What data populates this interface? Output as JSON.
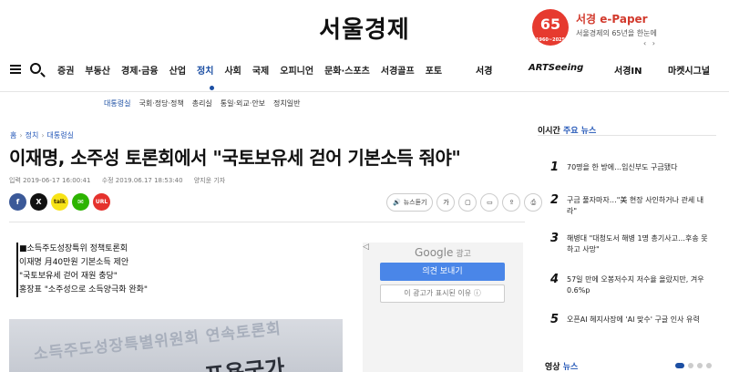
{
  "header": {
    "logo": "서울경제",
    "epaper": {
      "badge": "65",
      "badge_years": "1960~2025",
      "title": "서경 e-Paper",
      "subtitle": "서울경제의 65년을 한눈에",
      "arrows": "‹ ›"
    }
  },
  "nav": {
    "items": [
      "증권",
      "부동산",
      "경제·금융",
      "산업",
      "정치",
      "사회",
      "국제",
      "오피니언",
      "문화·스포츠",
      "서경골프",
      "포토"
    ],
    "active": "정치",
    "brands": [
      "서경",
      "ARTSeeing",
      "서경IN",
      "마켓시그널"
    ]
  },
  "subnav": {
    "items": [
      "대통령실",
      "국회·정당·정책",
      "총리실",
      "통일·외교·안보",
      "정치일반"
    ],
    "active": "대통령실"
  },
  "article": {
    "breadcrumb": [
      "홈",
      "정치",
      "대통령실"
    ],
    "headline": "이재명, 소주성 토론회에서 \"국토보유세 걷어 기본소득 줘야\"",
    "published": "입력 2019-06-17 16:00:41",
    "modified": "수정 2019.06.17 18:53:40",
    "author": "양지윤 기자",
    "share": [
      "f",
      "X",
      "talk",
      "✉",
      "URL"
    ],
    "tools": {
      "listen": "뉴스듣기",
      "font": "가"
    },
    "summary": [
      "■소득주도성장특위 정책토론회",
      "이재명 月40만원 기본소득 제안",
      "\"국토보유세 걷어 재원 충당\"",
      "홍장표 \"소주성으로 소득양극화 완화\""
    ],
    "photo_text": "소득주도성장특별위원회 연속토론회",
    "photo_text_big": "포용국가"
  },
  "ad": {
    "label": "Google",
    "label_small": "광고",
    "button_primary": "의견 보내기",
    "button_secondary": "이 광고가 표시된 이유 ⓘ",
    "close": "◁"
  },
  "sidebar": {
    "popular_title_a": "이시간",
    "popular_title_b": "주요 뉴스",
    "popular": [
      {
        "rank": "1",
        "text": "70명을 한 방에…임신부도 구금됐다"
      },
      {
        "rank": "2",
        "text": "구금 풀자마자…\"美 현장 사인하거나 관세 내라\""
      },
      {
        "rank": "3",
        "text": "해병대 \"대청도서 해병 1명 총기사고…후송 못하고 사망\""
      },
      {
        "rank": "4",
        "text": "57일 만에 오봉저수지 저수율 올랐지만, 겨우 0.6%p"
      },
      {
        "rank": "5",
        "text": "오픈AI 헤지사장에 'AI 맞수' 구글 인사 유력"
      }
    ],
    "video_title_a": "영상",
    "video_title_b": "뉴스"
  }
}
